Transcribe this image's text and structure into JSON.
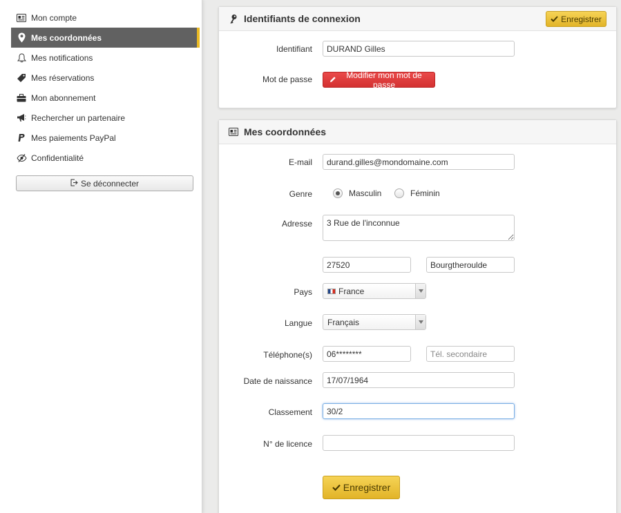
{
  "sidebar": {
    "items": [
      {
        "label": "Mon compte",
        "icon": "id-card-icon",
        "active": false
      },
      {
        "label": "Mes coordonnées",
        "icon": "map-pin-icon",
        "active": true
      },
      {
        "label": "Mes notifications",
        "icon": "bell-icon",
        "active": false
      },
      {
        "label": "Mes réservations",
        "icon": "tag-icon",
        "active": false
      },
      {
        "label": "Mon abonnement",
        "icon": "briefcase-icon",
        "active": false
      },
      {
        "label": "Rechercher un partenaire",
        "icon": "megaphone-icon",
        "active": false
      },
      {
        "label": "Mes paiements PayPal",
        "icon": "paypal-icon",
        "active": false
      },
      {
        "label": "Confidentialité",
        "icon": "eye-slash-icon",
        "active": false
      }
    ],
    "logout_label": "Se déconnecter"
  },
  "login_panel": {
    "title": "Identifiants de connexion",
    "save_label": "Enregistrer",
    "identifier_label": "Identifiant",
    "identifier_value": "DURAND Gilles",
    "password_label": "Mot de passe",
    "change_password_label": "Modifier mon mot de passe"
  },
  "contact_panel": {
    "title": "Mes coordonnées",
    "email_label": "E-mail",
    "email_value": "durand.gilles@mondomaine.com",
    "gender_label": "Genre",
    "gender_male": "Masculin",
    "gender_female": "Féminin",
    "gender_selected": "Masculin",
    "address_label": "Adresse",
    "address_value": "3 Rue de l'inconnue",
    "postal_code": "27520",
    "city": "Bourgtheroulde",
    "country_label": "Pays",
    "country_value": "France",
    "language_label": "Langue",
    "language_value": "Français",
    "phone_label": "Téléphone(s)",
    "phone_value": "06********",
    "phone2_placeholder": "Tél. secondaire",
    "birthdate_label": "Date de naissance",
    "birthdate_value": "17/07/1964",
    "ranking_label": "Classement",
    "ranking_value": "30/2",
    "license_label": "N° de licence",
    "license_value": "",
    "save_label": "Enregistrer"
  },
  "colors": {
    "accent_gold": "#e9b923",
    "active_nav_bg": "#616161",
    "danger_red": "#d33131"
  }
}
